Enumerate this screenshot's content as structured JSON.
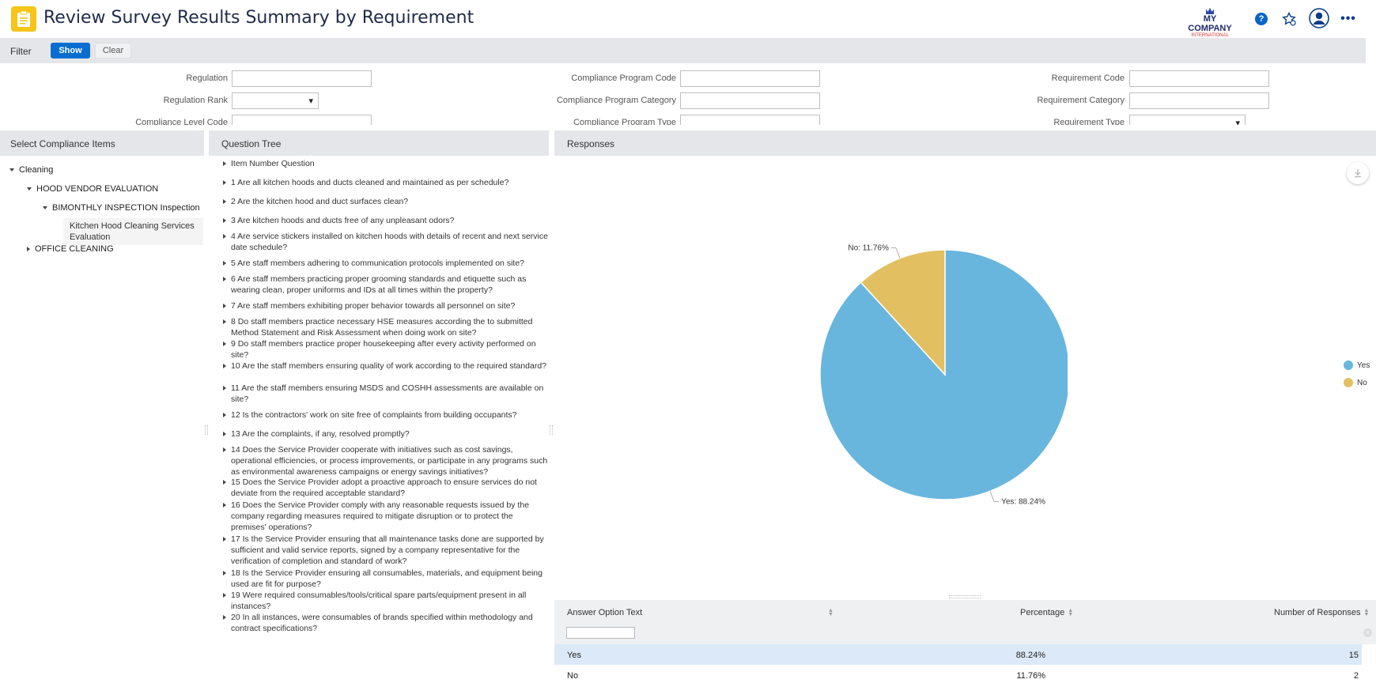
{
  "header": {
    "title": "Review Survey Results Summary by Requirement",
    "logo_line1": "MY COMPANY",
    "logo_line2": "INTERNATIONAL",
    "help_label": "?"
  },
  "filter": {
    "label": "Filter",
    "show_label": "Show",
    "clear_label": "Clear",
    "fields": {
      "regulation": "Regulation",
      "regulation_rank": "Regulation Rank",
      "compliance_level_code": "Compliance Level Code",
      "compliance_program_code": "Compliance Program Code",
      "compliance_program_category": "Compliance Program Category",
      "compliance_program_type": "Compliance Program Type",
      "requirement_code": "Requirement Code",
      "requirement_category": "Requirement Category",
      "requirement_type": "Requirement Type"
    }
  },
  "panels": {
    "left_title": "Select Compliance Items",
    "mid_title": "Question Tree",
    "right_title": "Responses"
  },
  "tree": {
    "root": "Cleaning",
    "child1": "HOOD VENDOR EVALUATION",
    "child1_1_bold": "BIMONTHLY INSPECTION",
    "child1_1_rest": "Inspection",
    "leaf": "Kitchen Hood Cleaning Services Evaluation",
    "child2": "OFFICE CLEANING"
  },
  "questions": [
    "Item Number Question",
    "1 Are all kitchen hoods and ducts cleaned and maintained as per schedule?",
    "2 Are the kitchen hood and duct surfaces clean?",
    "3 Are kitchen hoods and ducts free of any unpleasant odors?",
    "4 Are service stickers installed on kitchen hoods with details of recent and next service date schedule?",
    "5 Are staff members adhering to communication protocols implemented on site?",
    "6 Are staff members practicing proper grooming standards and etiquette such as wearing clean, proper uniforms and IDs at all times within the property?",
    "7 Are staff members exhibiting proper behavior towards all personnel on site?",
    "8 Do staff members practice necessary HSE measures according the to submitted Method Statement and Risk Assessment when doing work on site?",
    "9 Do staff members practice proper housekeeping after every activity performed on site?",
    "10 Are the staff members ensuring quality of work according to the required standard?",
    "11 Are the staff members ensuring MSDS and COSHH assessments are available on site?",
    "12 Is the contractors' work on site free of complaints from building occupants?",
    "13 Are the complaints, if any, resolved promptly?",
    "14 Does the Service Provider cooperate with initiatives such as cost savings, operational efficiencies, or process improvements, or participate in any programs such as environmental awareness campaigns or energy savings initiatives?",
    "15 Does the Service Provider adopt a proactive approach to ensure services do not deviate from the required acceptable standard?",
    "16 Does the Service Provider comply with any reasonable requests issued by the company regarding measures required to mitigate disruption or to protect the premises' operations?",
    "17 Is the Service Provider ensuring that all maintenance tasks done are supported by sufficient and valid service reports, signed by a company representative for the verification of completion and standard of work?",
    "18 Is the Service Provider ensuring all consumables, materials, and equipment being used are fit for purpose?",
    "19 Were required consumables/tools/critical spare parts/equipment present in all instances?",
    "20 In all instances, were consumables of brands specified within methodology and contract specifications?"
  ],
  "chart_data": {
    "type": "pie",
    "title": "",
    "slices": [
      {
        "name": "Yes",
        "value": 88.24,
        "label": "Yes: 88.24%",
        "color": "#68b6dd"
      },
      {
        "name": "No",
        "value": 11.76,
        "label": "No: 11.76%",
        "color": "#e2c062"
      }
    ],
    "legend": [
      "Yes",
      "No"
    ],
    "legend_position": "right"
  },
  "table": {
    "headers": [
      "Answer Option Text",
      "Percentage",
      "Number of Responses"
    ],
    "rows": [
      {
        "answer": "Yes",
        "percentage": "88.24%",
        "count": "15"
      },
      {
        "answer": "No",
        "percentage": "11.76%",
        "count": "2"
      }
    ]
  },
  "colors": {
    "accent": "#0a6ed1",
    "app_icon": "#f5c518",
    "selected_row": "#dbe9f8"
  }
}
